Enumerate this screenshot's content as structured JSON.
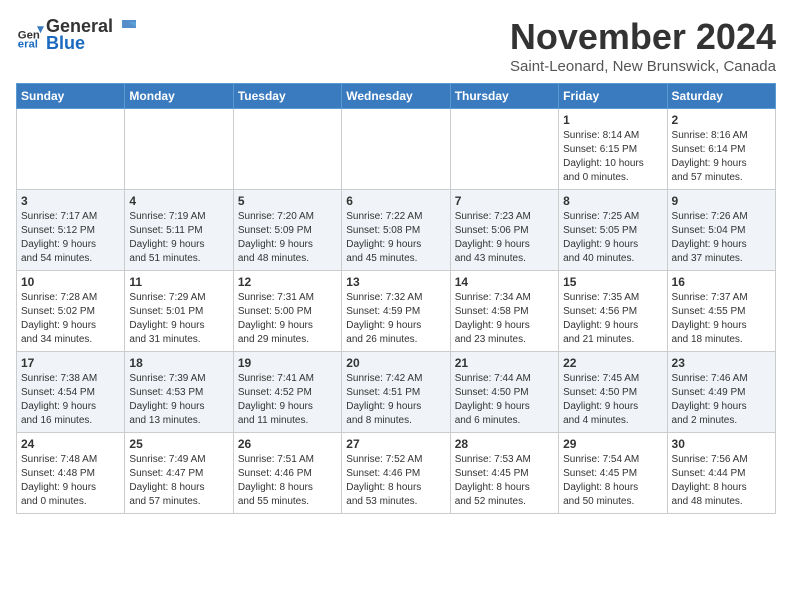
{
  "header": {
    "logo_line1": "General",
    "logo_line2": "Blue",
    "month_title": "November 2024",
    "location": "Saint-Leonard, New Brunswick, Canada"
  },
  "weekdays": [
    "Sunday",
    "Monday",
    "Tuesday",
    "Wednesday",
    "Thursday",
    "Friday",
    "Saturday"
  ],
  "weeks": [
    [
      {
        "day": "",
        "info": ""
      },
      {
        "day": "",
        "info": ""
      },
      {
        "day": "",
        "info": ""
      },
      {
        "day": "",
        "info": ""
      },
      {
        "day": "",
        "info": ""
      },
      {
        "day": "1",
        "info": "Sunrise: 8:14 AM\nSunset: 6:15 PM\nDaylight: 10 hours\nand 0 minutes."
      },
      {
        "day": "2",
        "info": "Sunrise: 8:16 AM\nSunset: 6:14 PM\nDaylight: 9 hours\nand 57 minutes."
      }
    ],
    [
      {
        "day": "3",
        "info": "Sunrise: 7:17 AM\nSunset: 5:12 PM\nDaylight: 9 hours\nand 54 minutes."
      },
      {
        "day": "4",
        "info": "Sunrise: 7:19 AM\nSunset: 5:11 PM\nDaylight: 9 hours\nand 51 minutes."
      },
      {
        "day": "5",
        "info": "Sunrise: 7:20 AM\nSunset: 5:09 PM\nDaylight: 9 hours\nand 48 minutes."
      },
      {
        "day": "6",
        "info": "Sunrise: 7:22 AM\nSunset: 5:08 PM\nDaylight: 9 hours\nand 45 minutes."
      },
      {
        "day": "7",
        "info": "Sunrise: 7:23 AM\nSunset: 5:06 PM\nDaylight: 9 hours\nand 43 minutes."
      },
      {
        "day": "8",
        "info": "Sunrise: 7:25 AM\nSunset: 5:05 PM\nDaylight: 9 hours\nand 40 minutes."
      },
      {
        "day": "9",
        "info": "Sunrise: 7:26 AM\nSunset: 5:04 PM\nDaylight: 9 hours\nand 37 minutes."
      }
    ],
    [
      {
        "day": "10",
        "info": "Sunrise: 7:28 AM\nSunset: 5:02 PM\nDaylight: 9 hours\nand 34 minutes."
      },
      {
        "day": "11",
        "info": "Sunrise: 7:29 AM\nSunset: 5:01 PM\nDaylight: 9 hours\nand 31 minutes."
      },
      {
        "day": "12",
        "info": "Sunrise: 7:31 AM\nSunset: 5:00 PM\nDaylight: 9 hours\nand 29 minutes."
      },
      {
        "day": "13",
        "info": "Sunrise: 7:32 AM\nSunset: 4:59 PM\nDaylight: 9 hours\nand 26 minutes."
      },
      {
        "day": "14",
        "info": "Sunrise: 7:34 AM\nSunset: 4:58 PM\nDaylight: 9 hours\nand 23 minutes."
      },
      {
        "day": "15",
        "info": "Sunrise: 7:35 AM\nSunset: 4:56 PM\nDaylight: 9 hours\nand 21 minutes."
      },
      {
        "day": "16",
        "info": "Sunrise: 7:37 AM\nSunset: 4:55 PM\nDaylight: 9 hours\nand 18 minutes."
      }
    ],
    [
      {
        "day": "17",
        "info": "Sunrise: 7:38 AM\nSunset: 4:54 PM\nDaylight: 9 hours\nand 16 minutes."
      },
      {
        "day": "18",
        "info": "Sunrise: 7:39 AM\nSunset: 4:53 PM\nDaylight: 9 hours\nand 13 minutes."
      },
      {
        "day": "19",
        "info": "Sunrise: 7:41 AM\nSunset: 4:52 PM\nDaylight: 9 hours\nand 11 minutes."
      },
      {
        "day": "20",
        "info": "Sunrise: 7:42 AM\nSunset: 4:51 PM\nDaylight: 9 hours\nand 8 minutes."
      },
      {
        "day": "21",
        "info": "Sunrise: 7:44 AM\nSunset: 4:50 PM\nDaylight: 9 hours\nand 6 minutes."
      },
      {
        "day": "22",
        "info": "Sunrise: 7:45 AM\nSunset: 4:50 PM\nDaylight: 9 hours\nand 4 minutes."
      },
      {
        "day": "23",
        "info": "Sunrise: 7:46 AM\nSunset: 4:49 PM\nDaylight: 9 hours\nand 2 minutes."
      }
    ],
    [
      {
        "day": "24",
        "info": "Sunrise: 7:48 AM\nSunset: 4:48 PM\nDaylight: 9 hours\nand 0 minutes."
      },
      {
        "day": "25",
        "info": "Sunrise: 7:49 AM\nSunset: 4:47 PM\nDaylight: 8 hours\nand 57 minutes."
      },
      {
        "day": "26",
        "info": "Sunrise: 7:51 AM\nSunset: 4:46 PM\nDaylight: 8 hours\nand 55 minutes."
      },
      {
        "day": "27",
        "info": "Sunrise: 7:52 AM\nSunset: 4:46 PM\nDaylight: 8 hours\nand 53 minutes."
      },
      {
        "day": "28",
        "info": "Sunrise: 7:53 AM\nSunset: 4:45 PM\nDaylight: 8 hours\nand 52 minutes."
      },
      {
        "day": "29",
        "info": "Sunrise: 7:54 AM\nSunset: 4:45 PM\nDaylight: 8 hours\nand 50 minutes."
      },
      {
        "day": "30",
        "info": "Sunrise: 7:56 AM\nSunset: 4:44 PM\nDaylight: 8 hours\nand 48 minutes."
      }
    ]
  ]
}
